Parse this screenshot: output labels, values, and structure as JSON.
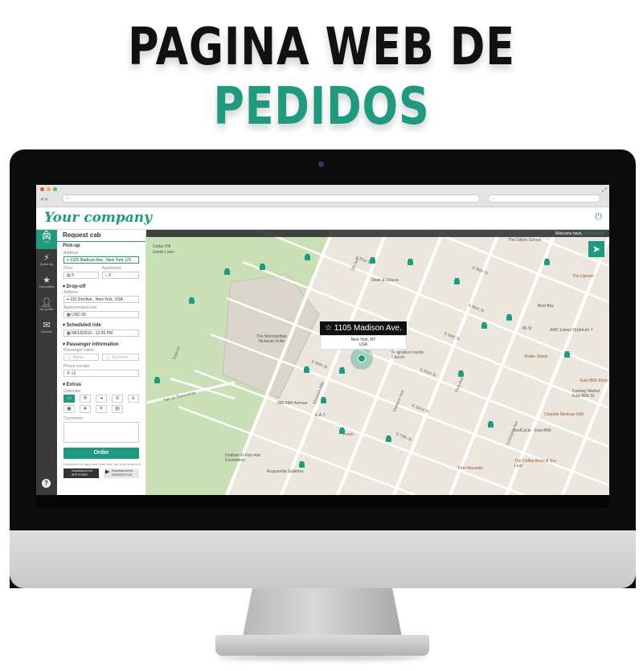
{
  "headline": {
    "part1": "PAGINA WEB DE",
    "part2": "PEDIDOS"
  },
  "colors": {
    "accent": "#1f9a7e",
    "dark": "#111111"
  },
  "browser": {
    "url_placeholder": "+",
    "search_placeholder": "○"
  },
  "app": {
    "logo": "Your company",
    "power_icon": "power-icon"
  },
  "nav": [
    {
      "label": "Taxi",
      "icon": "taxi-icon"
    },
    {
      "label": "Quick trip",
      "icon": "bolt-icon"
    },
    {
      "label": "Favourites",
      "icon": "star-icon"
    },
    {
      "label": "My profile",
      "icon": "user-icon"
    },
    {
      "label": "Contact",
      "icon": "mail-icon"
    }
  ],
  "panel": {
    "title": "Request cab",
    "pickup": {
      "section": "Pick-up",
      "address_label": "Address",
      "address_value": "1105 Madison Ave., New York, US",
      "floor_label": "Floor",
      "floor_value": "5",
      "apartment_label": "Apartment",
      "apartment_value": "5"
    },
    "dropoff": {
      "section": "▾ Drop-off",
      "address_label": "Address",
      "address_value": "110 2nd Ave., New York, USA",
      "cost_label": "Approximated cost",
      "cost_value": "USD 30"
    },
    "scheduled": {
      "section": "▾ Scheduled ride",
      "value": "04/13/2015 - 12:05 PM"
    },
    "passenger": {
      "section": "▾ Passenger information",
      "name_label": "Passenger name",
      "name_placeholder": "Name",
      "surname_placeholder": "Surname",
      "phone_label": "Phone number",
      "phone_value": "+1"
    },
    "extras": {
      "section": "▾ Extras",
      "label": "Optionals"
    },
    "comments_label": "Comments",
    "order_button": "Order",
    "download_text": "Download our apps and order your taxi from anywhere",
    "app_store": "Download on the APP STORE",
    "google_play": "Download on the ANDROID PLAY"
  },
  "map": {
    "welcome_prefix": "Welcome back,",
    "welcome_user": "(username)",
    "popup_title": "1105 Madison Ave.",
    "popup_line1": "New York, NY",
    "popup_line2": "USA",
    "pois": {
      "museum": "The Metropolitan Museum of Art",
      "cedar": "Cedar Hill",
      "dalton": "The Dalton School",
      "dean": "Dean & Deluca",
      "uptown": "The Uptown",
      "bestbuy": "Best Buy",
      "amc": "AMC Loews Orpheum 7",
      "shake": "Shake Shack",
      "ignatius": "St Ignatius Loyola Church",
      "bistro": "East 85th Bistro",
      "fairway": "Fairway Market East 86th St",
      "chipotle": "Chipotle Mexican Grill",
      "soulcycle": "SoulCycle - East 86th",
      "coffee": "The Coffee Bean & Tea Leaf",
      "firm": "Firm Mussells",
      "eat": "E.A.T.",
      "fresh": "Fresh",
      "fine_arts": "Institute of Fine Arts Foundation",
      "acquavella": "Acquavella Galleries",
      "fifth": "990 Fifth Avenue",
      "greek": "Greek Lawn",
      "metro_lbl": "86 St"
    },
    "streets": {
      "e86": "E 86th St",
      "e85": "E 85th St",
      "e84": "E 84th St",
      "e83": "E 83rd St",
      "e82": "E 82nd St",
      "e81": "E 81st St",
      "e80": "E 80th St",
      "e79": "E 79th St",
      "madison": "Madison Ave",
      "park": "Park Ave",
      "lexington": "Lexington Ave",
      "fifthave": "5th Ave",
      "transverse": "79th St Transverse",
      "museummile": "Museum Mile",
      "east_dr": "East Dr"
    }
  }
}
